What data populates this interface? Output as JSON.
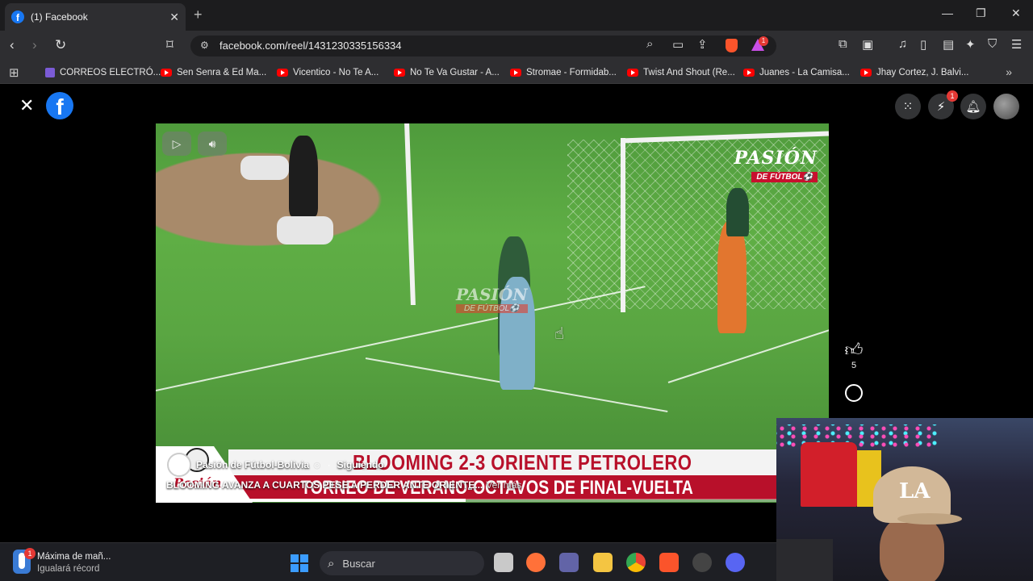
{
  "browser": {
    "tab_title": "(1) Facebook",
    "tab_close": "✕",
    "new_tab": "+",
    "url": "facebook.com/reel/1431230335156334",
    "window_controls": {
      "minimize": "—",
      "maximize": "❐",
      "close": "✕"
    },
    "extension_badge": "1"
  },
  "bookmarks": [
    {
      "label": "CORREOS ELECTRÓ...",
      "icon": "doc"
    },
    {
      "label": "Sen Senra & Ed Ma...",
      "icon": "youtube"
    },
    {
      "label": "Vicentico - No Te A...",
      "icon": "youtube"
    },
    {
      "label": "No Te Va Gustar - A...",
      "icon": "youtube"
    },
    {
      "label": "Stromae - Formidab...",
      "icon": "youtube"
    },
    {
      "label": "Twist And Shout (Re...",
      "icon": "youtube"
    },
    {
      "label": "Juanes - La Camisa...",
      "icon": "youtube"
    },
    {
      "label": "Jhay Cortez, J. Balvi...",
      "icon": "youtube"
    }
  ],
  "facebook": {
    "logo": "f",
    "close": "✕",
    "messenger_badge": "1",
    "reel": {
      "page_name": "Pasión de Fútbol-Bolivia",
      "separator": "·",
      "follow_status": "Siguiendo",
      "caption": "BLOOMING AVANZA A CUARTOS PESE A PERDER ANTE ORIENTE...",
      "caption_more": "Ver más",
      "overlay_title": "BLOOMING 2-3 ORIENTE PETROLERO",
      "overlay_subtitle": "TORNEO DE VERANO-OCTAVOS DE FINAL-VUELTA",
      "watermark_top": "PASIÓN",
      "watermark_bottom": "DE FÚTBOL⚽",
      "logo_text": "Pasión",
      "progress": 0.46,
      "likes": "5"
    }
  },
  "taskbar": {
    "weather_title": "Máxima de mañ...",
    "weather_sub": "Igualará récord",
    "weather_badge": "1",
    "search_placeholder": "Buscar"
  },
  "webcam": {
    "cap_logo": "LA"
  }
}
